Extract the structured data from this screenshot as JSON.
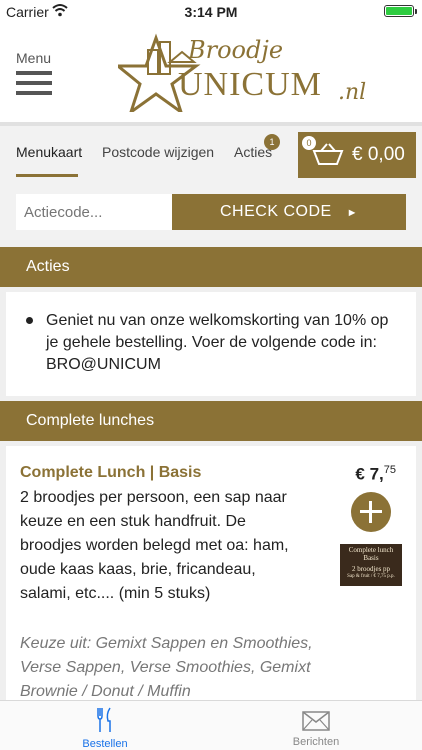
{
  "status_bar": {
    "carrier": "Carrier",
    "time": "3:14 PM"
  },
  "header": {
    "menu_label": "Menu",
    "logo": {
      "broodje": "Broodje",
      "unicum": "UNICUM",
      "nl": ".nl"
    }
  },
  "tabs": [
    {
      "label": "Menukaart",
      "active": true
    },
    {
      "label": "Postcode wijzigen",
      "active": false
    },
    {
      "label": "Acties",
      "active": false,
      "badge": "1"
    }
  ],
  "cart": {
    "count": "0",
    "total": "€ 0,00"
  },
  "action_code": {
    "placeholder": "Actiecode...",
    "button_label": "CHECK CODE",
    "button_icon": "►"
  },
  "sections": {
    "acties": {
      "title": "Acties",
      "items": [
        "Geniet nu van onze welkomskorting van 10% op je gehele bestelling. Voer de volgende code in: BRO@UNICUM"
      ]
    },
    "lunches": {
      "title": "Complete lunches",
      "product": {
        "name": "Complete Lunch | Basis",
        "price_euros": "€ 7,",
        "price_cents": "75",
        "description": "2 broodjes per persoon, een sap naar keuze en een stuk handfruit. De broodjes worden belegd met oa: ham, oude kaas kaas, brie, fricandeau, salami, etc.... (min 5 stuks)",
        "choices": "Keuze uit: Gemixt Sappen en Smoothies, Verse Sappen, Verse Smoothies, Gemixt Brownie / Donut / Muffin",
        "thumbnail": {
          "line1": "Complete lunch",
          "line2": "Basis",
          "line3": "2 broodjes pp",
          "line4": "Sap & fruit / € 7,75 p.p."
        }
      }
    }
  },
  "bottom_nav": [
    {
      "label": "Bestellen",
      "icon": "fork-knife-icon",
      "active": true
    },
    {
      "label": "Berichten",
      "icon": "envelope-icon",
      "active": false
    }
  ],
  "colors": {
    "brand": "#8b7236",
    "active_nav": "#1a73e8"
  }
}
